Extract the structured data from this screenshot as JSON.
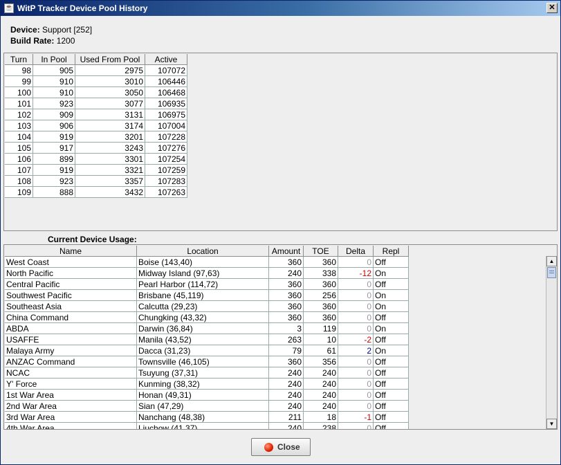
{
  "window": {
    "title": "WitP Tracker Device Pool History",
    "close_glyph": "✕"
  },
  "device": {
    "label": "Device:",
    "value": "Support [252]"
  },
  "build_rate": {
    "label": "Build Rate:",
    "value": "1200"
  },
  "history": {
    "columns": [
      "Turn",
      "In Pool",
      "Used From Pool",
      "Active"
    ],
    "rows": [
      [
        "98",
        "905",
        "2975",
        "107072"
      ],
      [
        "99",
        "910",
        "3010",
        "106446"
      ],
      [
        "100",
        "910",
        "3050",
        "106468"
      ],
      [
        "101",
        "923",
        "3077",
        "106935"
      ],
      [
        "102",
        "909",
        "3131",
        "106975"
      ],
      [
        "103",
        "906",
        "3174",
        "107004"
      ],
      [
        "104",
        "919",
        "3201",
        "107228"
      ],
      [
        "105",
        "917",
        "3243",
        "107276"
      ],
      [
        "106",
        "899",
        "3301",
        "107254"
      ],
      [
        "107",
        "919",
        "3321",
        "107259"
      ],
      [
        "108",
        "923",
        "3357",
        "107283"
      ],
      [
        "109",
        "888",
        "3432",
        "107263"
      ]
    ]
  },
  "usage": {
    "label": "Current Device Usage:",
    "columns": [
      "Name",
      "Location",
      "Amount",
      "TOE",
      "Delta",
      "Repl"
    ],
    "rows": [
      [
        "West Coast",
        "Boise (143,40)",
        "360",
        "360",
        "0",
        "Off"
      ],
      [
        "North Pacific",
        "Midway Island (97,63)",
        "240",
        "338",
        "-12",
        "On"
      ],
      [
        "Central Pacific",
        "Pearl Harbor (114,72)",
        "360",
        "360",
        "0",
        "Off"
      ],
      [
        "Southwest Pacific",
        "Brisbane (45,119)",
        "360",
        "256",
        "0",
        "On"
      ],
      [
        "Southeast Asia",
        "Calcutta (29,23)",
        "360",
        "360",
        "0",
        "On"
      ],
      [
        "China Command",
        "Chungking (43,32)",
        "360",
        "360",
        "0",
        "Off"
      ],
      [
        "ABDA",
        "Darwin (36,84)",
        "3",
        "119",
        "0",
        "On"
      ],
      [
        "USAFFE",
        "Manila (43,52)",
        "263",
        "10",
        "-2",
        "Off"
      ],
      [
        "Malaya Army",
        "Dacca (31,23)",
        "79",
        "61",
        "2",
        "On"
      ],
      [
        "ANZAC Command",
        "Townsville (46,105)",
        "360",
        "356",
        "0",
        "Off"
      ],
      [
        "NCAC",
        "Tsuyung (37,31)",
        "240",
        "240",
        "0",
        "Off"
      ],
      [
        "Y' Force",
        "Kunming (38,32)",
        "240",
        "240",
        "0",
        "Off"
      ],
      [
        "1st War Area",
        "Honan (49,31)",
        "240",
        "240",
        "0",
        "Off"
      ],
      [
        "2nd War Area",
        "Sian (47,29)",
        "240",
        "240",
        "0",
        "Off"
      ],
      [
        "3rd War Area",
        "Nanchang (48,38)",
        "211",
        "18",
        "-1",
        "Off"
      ],
      [
        "4th War Area",
        "Liuchow (41,37)",
        "240",
        "238",
        "0",
        "Off"
      ]
    ]
  },
  "scrollbar": {
    "up_glyph": "▲",
    "down_glyph": "▼"
  },
  "close_button": {
    "label": "Close"
  }
}
